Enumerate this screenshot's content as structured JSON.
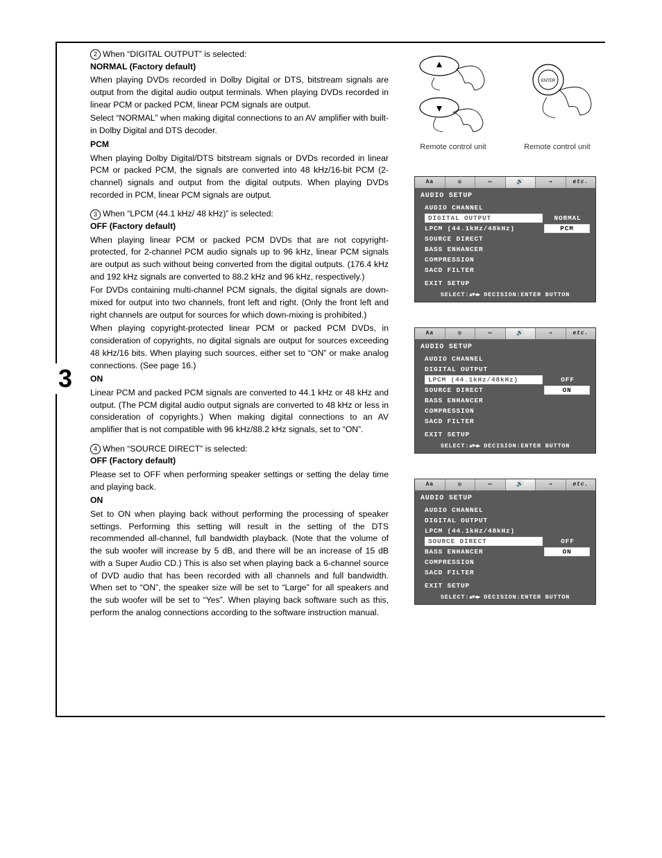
{
  "step_number": "3",
  "section2": {
    "lead": "When “DIGITAL OUTPUT” is selected:",
    "normal_title": "NORMAL (Factory default)",
    "normal_p1": "When playing DVDs recorded in Dolby Digital or DTS, bitstream signals are output from the digital audio output terminals. When playing DVDs recorded in linear PCM or packed PCM, linear PCM signals are output.",
    "normal_p2": "Select “NORMAL” when making digital connections to an AV amplifier with built-in Dolby Digital and DTS decoder.",
    "pcm_title": "PCM",
    "pcm_p1": "When playing Dolby Digital/DTS bitstream signals or DVDs recorded in linear PCM or packed PCM, the signals are converted into 48 kHz/16-bit PCM (2-channel) signals and output from the digital outputs. When playing DVDs recorded in PCM, linear PCM signals are output."
  },
  "section3": {
    "lead": "When “LPCM (44.1 kHz/ 48 kHz)” is selected:",
    "off_title": "OFF (Factory default)",
    "off_p1": "When playing linear PCM or packed PCM DVDs that are not copyright-protected, for 2-channel PCM audio signals up to 96 kHz, linear PCM signals are output as such without being converted from the digital outputs. (176.4 kHz and 192 kHz signals are converted to 88.2 kHz and 96 kHz, respectively.)",
    "off_p2": "For DVDs containing multi-channel PCM signals, the digital signals are down-mixed for output into two channels, front left and right. (Only the front left and right channels are output for sources for which down-mixing is prohibited.)",
    "off_p3": "When playing copyright-protected linear PCM or packed PCM DVDs, in consideration of copyrights, no digital signals are output for sources exceeding 48 kHz/16 bits. When playing such sources, either set to “ON” or make analog connections. (See page 16.)",
    "on_title": "ON",
    "on_p1": "Linear PCM and packed PCM signals are converted to 44.1 kHz or 48 kHz and output. (The PCM digital audio output signals are converted to 48 kHz or less in consideration of copyrights.) When making digital connections to an AV amplifier that is not compatible with 96 kHz/88.2 kHz signals, set to “ON”."
  },
  "section4": {
    "lead": "When “SOURCE DIRECT” is selected:",
    "off_title": "OFF (Factory default)",
    "off_p1": "Please set to OFF when performing speaker settings or setting the delay time and playing back.",
    "on_title": "ON",
    "on_p1": "Set to ON when playing back without performing the processing of speaker settings. Performing this setting will result in the setting of the DTS recommended all-channel, full bandwidth playback. (Note that the volume of the sub woofer will increase by 5 dB, and there will be an increase of 15 dB with a Super Audio CD.) This is also set when playing back a 6-channel source of DVD audio that has been recorded with all channels and full bandwidth. When set to “ON”, the speaker size will be set to “Large” for all speakers and the sub woofer will be set to “Yes”. When playing back software such as this, perform the analog connections according to the software instruction manual."
  },
  "remote_label": "Remote control unit",
  "enter_label": "ENTER",
  "osd": {
    "tabs_etc": "etc.",
    "title": "AUDIO SETUP",
    "items": {
      "audio_channel": "AUDIO CHANNEL",
      "digital_output": "DIGITAL OUTPUT",
      "lpcm": "LPCM (44.1kHz/48kHz)",
      "source_direct": "SOURCE DIRECT",
      "bass_enhancer": "BASS ENHANCER",
      "compression": "COMPRESSION",
      "sacd_filter": "SACD FILTER"
    },
    "values": {
      "normal": "NORMAL",
      "pcm": "PCM",
      "off": "OFF",
      "on": "ON"
    },
    "exit": "EXIT SETUP",
    "footer_select": "SELECT:",
    "footer_decision": "DECISION:ENTER BUTTON"
  }
}
